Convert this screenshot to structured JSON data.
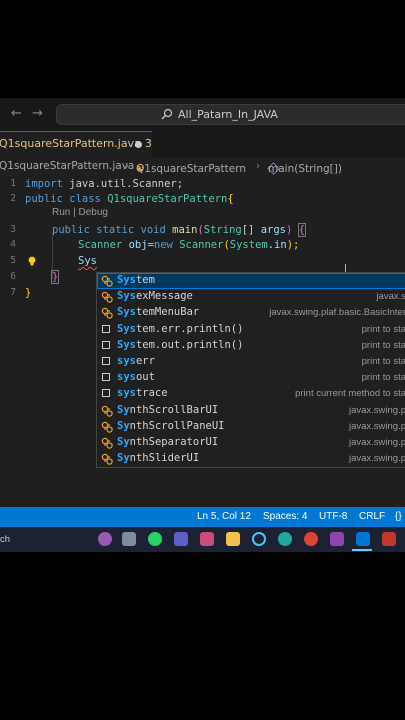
{
  "title_bar": {
    "back_icon": "arrow-left",
    "forward_icon": "arrow-right",
    "search_text": "All_Patarn_In_JAVA"
  },
  "tab": {
    "filename": "Q1squareStarPattern.java",
    "problems": "3"
  },
  "breadcrumbs": {
    "file": "Q1squareStarPattern.java",
    "class": "Q1squareStarPattern",
    "method": "main(String[])"
  },
  "editor": {
    "line_numbers": [
      "1",
      "2",
      "",
      "3",
      "4",
      "5",
      "6",
      "7"
    ],
    "codelens": "Run | Debug",
    "lines": {
      "l1": [
        "import",
        " java.util.Scanner;"
      ],
      "l2": [
        "public",
        " ",
        "class",
        " ",
        "Q1squareStarPattern",
        "{"
      ],
      "l3": [
        "public",
        " ",
        "static",
        " ",
        "void",
        " ",
        "main",
        "(",
        "String",
        "[] ",
        "args",
        ") ",
        "{"
      ],
      "l4": [
        "Scanner",
        " ",
        "obj",
        "=",
        "new",
        " ",
        "Scanner",
        "(",
        "System",
        ".",
        "in",
        ");"
      ],
      "l5": [
        "Sys"
      ],
      "l6": [
        "}"
      ],
      "l7": [
        "}"
      ]
    }
  },
  "suggestions": [
    {
      "match": "Sys",
      "rest": "tem",
      "detail": "",
      "kind": "class"
    },
    {
      "match": "Sys",
      "rest": "exMessage",
      "detail": "javax.s",
      "kind": "class"
    },
    {
      "match": "Sys",
      "rest": "temMenuBar",
      "detail": "javax.swing.plaf.basic.BasicInter",
      "kind": "class"
    },
    {
      "match": "Sys",
      "rest": "tem.err.println()",
      "detail": "print to sta",
      "kind": "snippet"
    },
    {
      "match": "Sys",
      "rest": "tem.out.println()",
      "detail": "print to sta",
      "kind": "snippet"
    },
    {
      "match": "sys",
      "rest": "err",
      "detail": "print to sta",
      "kind": "snippet"
    },
    {
      "match": "sys",
      "rest": "out",
      "detail": "print to sta",
      "kind": "snippet"
    },
    {
      "match": "sys",
      "rest": "trace",
      "detail": "print current method to sta",
      "kind": "snippet"
    },
    {
      "match": "Sy",
      "rest": "nthScrollBarUI",
      "detail": "javax.swing.p",
      "kind": "class"
    },
    {
      "match": "Sy",
      "rest": "nthScrollPaneUI",
      "detail": "javax.swing.p",
      "kind": "class"
    },
    {
      "match": "Sy",
      "rest": "nthSeparatorUI",
      "detail": "javax.swing.p",
      "kind": "class"
    },
    {
      "match": "Sy",
      "rest": "nthSliderUI",
      "detail": "javax.swing.p",
      "kind": "class"
    }
  ],
  "status_bar": {
    "position": "Ln 5, Col 12",
    "spaces": "Spaces: 4",
    "encoding": "UTF-8",
    "eol": "CRLF",
    "lang": "{}"
  },
  "taskbar": {
    "search_fragment": "ch"
  },
  "colors": {
    "status_bar": "#0078d4",
    "editor_bg": "#1f1f1f",
    "selection": "#04395e",
    "match_highlight": "#2aaaff"
  }
}
